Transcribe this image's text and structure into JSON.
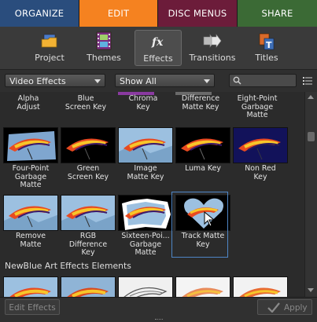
{
  "tabs": [
    "ORGANIZE",
    "EDIT",
    "DISC MENUS",
    "SHARE"
  ],
  "subtoolbar": {
    "project": "Project",
    "themes": "Themes",
    "effects": "Effects",
    "transitions": "Transitions",
    "titles": "Titles"
  },
  "filter": {
    "category": "Video Effects",
    "show": "Show All",
    "search_placeholder": ""
  },
  "grid": {
    "row0": [
      "Alpha\nAdjust",
      "Blue\nScreen Key",
      "Chroma\nKey",
      "Difference\nMatte Key",
      "Eight-Point\nGarbage\nMatte"
    ],
    "row1": [
      "Four-Point\nGarbage\nMatte",
      "Green\nScreen Key",
      "Image\nMatte Key",
      "Luma Key",
      "Non Red\nKey"
    ],
    "row2": [
      "Remove\nMatte",
      "RGB\nDifference\nKey",
      "Sixteen-Poi...\nGarbage\nMatte",
      "Track Matte\nKey"
    ],
    "section_title": "NewBlue Art Effects Elements",
    "selected": "Track Matte Key"
  },
  "bottom": {
    "edit_effects": "Edit Effects",
    "apply": "Apply"
  },
  "colors": {
    "organize": "#2a4d7d",
    "edit": "#f58220",
    "disc_menus": "#6c1c3a",
    "share": "#3b6a35",
    "selection": "#4f86c6"
  }
}
